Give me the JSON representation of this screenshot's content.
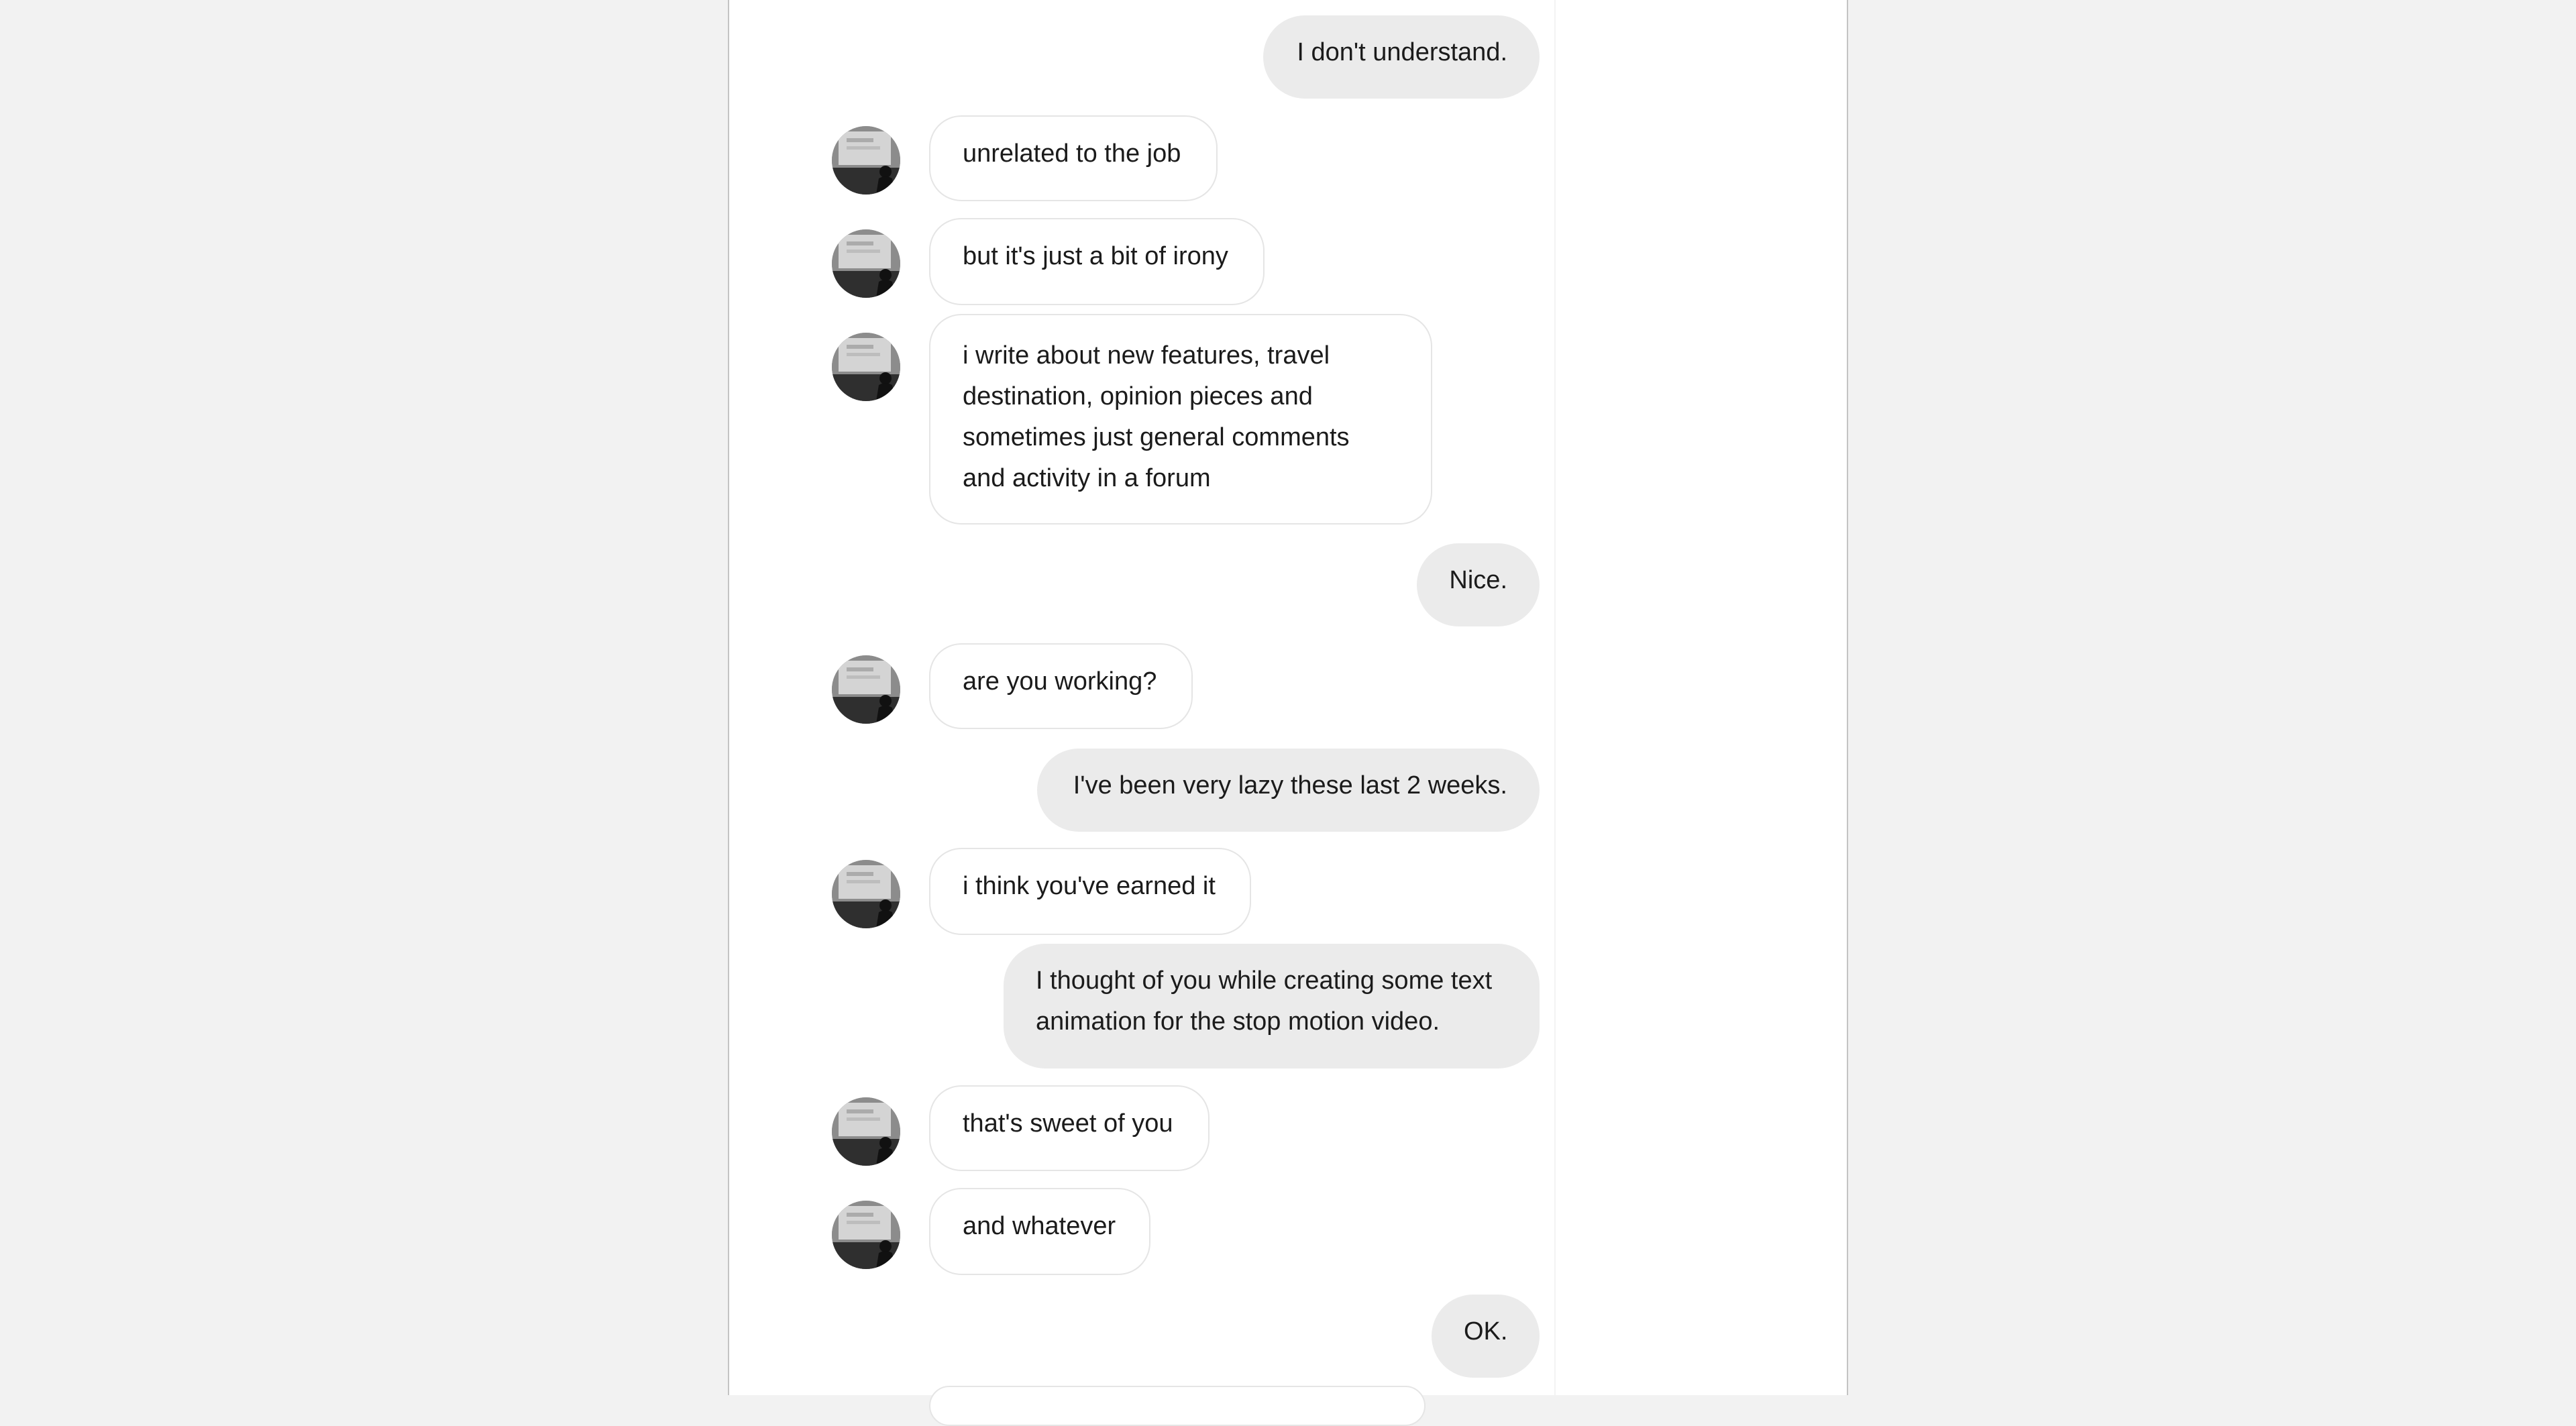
{
  "conversation": {
    "messages": [
      {
        "direction": "outgoing",
        "text": "I don't understand."
      },
      {
        "direction": "incoming",
        "text": "unrelated to the job"
      },
      {
        "direction": "incoming",
        "text": "but it's just a bit of irony"
      },
      {
        "direction": "incoming",
        "text": "i write about new features, travel destination, opinion pieces and sometimes just general comments and activity in a forum"
      },
      {
        "direction": "outgoing",
        "text": "Nice."
      },
      {
        "direction": "incoming",
        "text": "are you working?"
      },
      {
        "direction": "outgoing",
        "text": "I've been very lazy these last 2 weeks."
      },
      {
        "direction": "incoming",
        "text": "i think you've earned it"
      },
      {
        "direction": "outgoing",
        "text": "I thought of you while creating some text animation for the stop motion video."
      },
      {
        "direction": "incoming",
        "text": "that's sweet of you"
      },
      {
        "direction": "incoming",
        "text": "and whatever"
      },
      {
        "direction": "outgoing",
        "text": "OK."
      }
    ]
  },
  "avatar": {
    "icon": "user-photo-avatar"
  },
  "colors": {
    "page_background": "#f2f2f2",
    "chat_background": "#ffffff",
    "outgoing_bubble": "#ebebeb",
    "incoming_bubble_border": "#e5e5e5",
    "text": "#1b1b1b"
  }
}
